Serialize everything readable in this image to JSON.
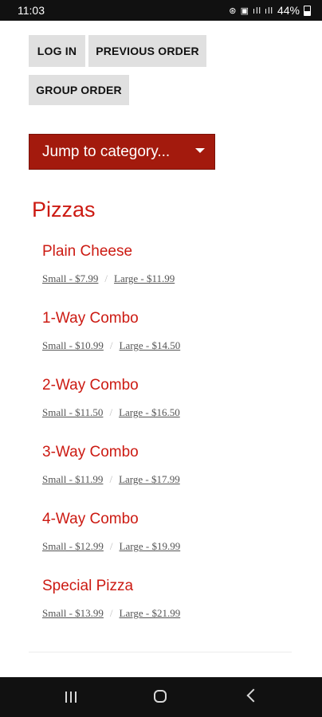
{
  "status_bar": {
    "time": "11:03",
    "icons": "⊛ ▣ ıll ıll",
    "battery": "44%"
  },
  "buttons": {
    "login": "LOG IN",
    "previous_order": "PREVIOUS ORDER",
    "group_order": "GROUP ORDER"
  },
  "category_select": {
    "label": "Jump to category..."
  },
  "section": {
    "title": "Pizzas"
  },
  "items": [
    {
      "name": "Plain Cheese",
      "small": "Small - $7.99",
      "large": "Large - $11.99"
    },
    {
      "name": "1-Way Combo",
      "small": "Small - $10.99",
      "large": "Large - $14.50"
    },
    {
      "name": "2-Way Combo",
      "small": "Small - $11.50",
      "large": "Large - $16.50"
    },
    {
      "name": "3-Way Combo",
      "small": "Small - $11.99",
      "large": "Large - $17.99"
    },
    {
      "name": "4-Way Combo",
      "small": "Small - $12.99",
      "large": "Large - $19.99"
    },
    {
      "name": "Special Pizza",
      "small": "Small - $13.99",
      "large": "Large - $21.99"
    }
  ],
  "colors": {
    "accent": "#cc1a12",
    "dropdown_bg": "#a31a0d",
    "button_bg": "#e0e0e0"
  }
}
